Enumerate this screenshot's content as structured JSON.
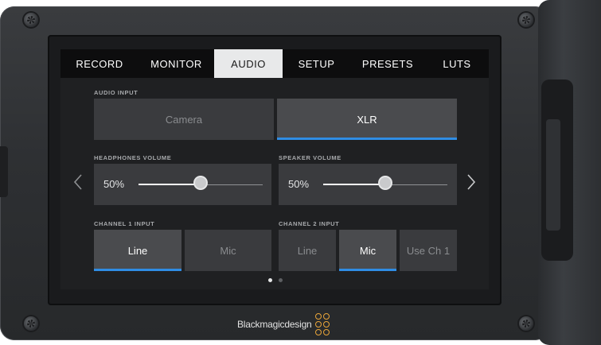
{
  "tabs": [
    {
      "label": "RECORD",
      "active": false
    },
    {
      "label": "MONITOR",
      "active": false
    },
    {
      "label": "AUDIO",
      "active": true
    },
    {
      "label": "SETUP",
      "active": false
    },
    {
      "label": "PRESETS",
      "active": false
    },
    {
      "label": "LUTS",
      "active": false
    }
  ],
  "audio_input": {
    "label": "AUDIO INPUT",
    "options": [
      "Camera",
      "XLR"
    ],
    "selected": "XLR"
  },
  "headphones_volume": {
    "label": "HEADPHONES VOLUME",
    "value_text": "50%",
    "level": 0.5
  },
  "speaker_volume": {
    "label": "SPEAKER VOLUME",
    "value_text": "50%",
    "level": 0.5
  },
  "channel1_input": {
    "label": "CHANNEL 1 INPUT",
    "options": [
      "Line",
      "Mic"
    ],
    "selected": "Line"
  },
  "channel2_input": {
    "label": "CHANNEL 2 INPUT",
    "options": [
      "Line",
      "Mic",
      "Use Ch 1"
    ],
    "selected": "Mic"
  },
  "pagination": {
    "current": 1,
    "total": 2
  },
  "icons": {
    "prev": "chevron-left-icon",
    "next": "chevron-right-icon"
  },
  "brand": {
    "name": "Blackmagicdesign",
    "accent": "#e9a53a"
  },
  "colors": {
    "selection_accent": "#2f8de4",
    "active_tab_bg": "#e8e9ea"
  }
}
